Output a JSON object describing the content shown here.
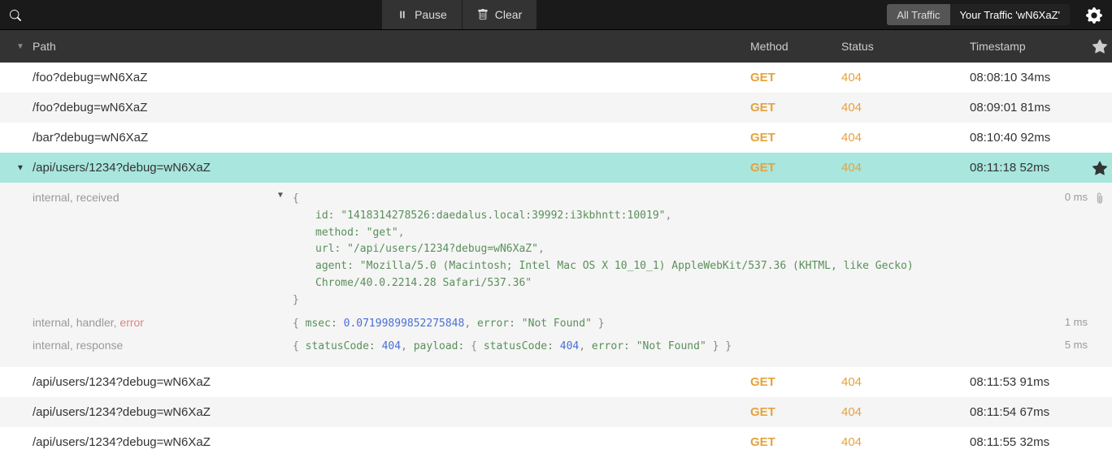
{
  "toolbar": {
    "pause_label": "Pause",
    "clear_label": "Clear",
    "all_traffic_label": "All Traffic",
    "your_traffic_label": "Your Traffic 'wN6XaZ'"
  },
  "columns": {
    "path": "Path",
    "method": "Method",
    "status": "Status",
    "timestamp": "Timestamp"
  },
  "rows": [
    {
      "path": "/foo?debug=wN6XaZ",
      "method": "GET",
      "status": "404",
      "timestamp": "08:08:10 34ms",
      "selected": false
    },
    {
      "path": "/foo?debug=wN6XaZ",
      "method": "GET",
      "status": "404",
      "timestamp": "08:09:01 81ms",
      "selected": false
    },
    {
      "path": "/bar?debug=wN6XaZ",
      "method": "GET",
      "status": "404",
      "timestamp": "08:10:40 92ms",
      "selected": false
    },
    {
      "path": "/api/users/1234?debug=wN6XaZ",
      "method": "GET",
      "status": "404",
      "timestamp": "08:11:18 52ms",
      "selected": true
    },
    {
      "path": "/api/users/1234?debug=wN6XaZ",
      "method": "GET",
      "status": "404",
      "timestamp": "08:11:53 91ms",
      "selected": false
    },
    {
      "path": "/api/users/1234?debug=wN6XaZ",
      "method": "GET",
      "status": "404",
      "timestamp": "08:11:54 67ms",
      "selected": false
    },
    {
      "path": "/api/users/1234?debug=wN6XaZ",
      "method": "GET",
      "status": "404",
      "timestamp": "08:11:55 32ms",
      "selected": false
    }
  ],
  "details": {
    "received": {
      "tags": "internal, received",
      "time": "0 ms",
      "json": {
        "id": "1418314278526:daedalus.local:39992:i3kbhntt:10019",
        "method": "get",
        "url": "/api/users/1234?debug=wN6XaZ",
        "agent": "Mozilla/5.0 (Macintosh; Intel Mac OS X 10_10_1) AppleWebKit/537.36 (KHTML, like Gecko) Chrome/40.0.2214.28 Safari/537.36"
      }
    },
    "handler": {
      "tags_prefix": "internal, handler, ",
      "tags_error": "error",
      "time": "1 ms",
      "msec": 0.07199899852275848,
      "error": "Not Found"
    },
    "response": {
      "tags": "internal, response",
      "time": "5 ms",
      "statusCode": 404,
      "payload": {
        "statusCode": 404,
        "error": "Not Found"
      }
    }
  }
}
